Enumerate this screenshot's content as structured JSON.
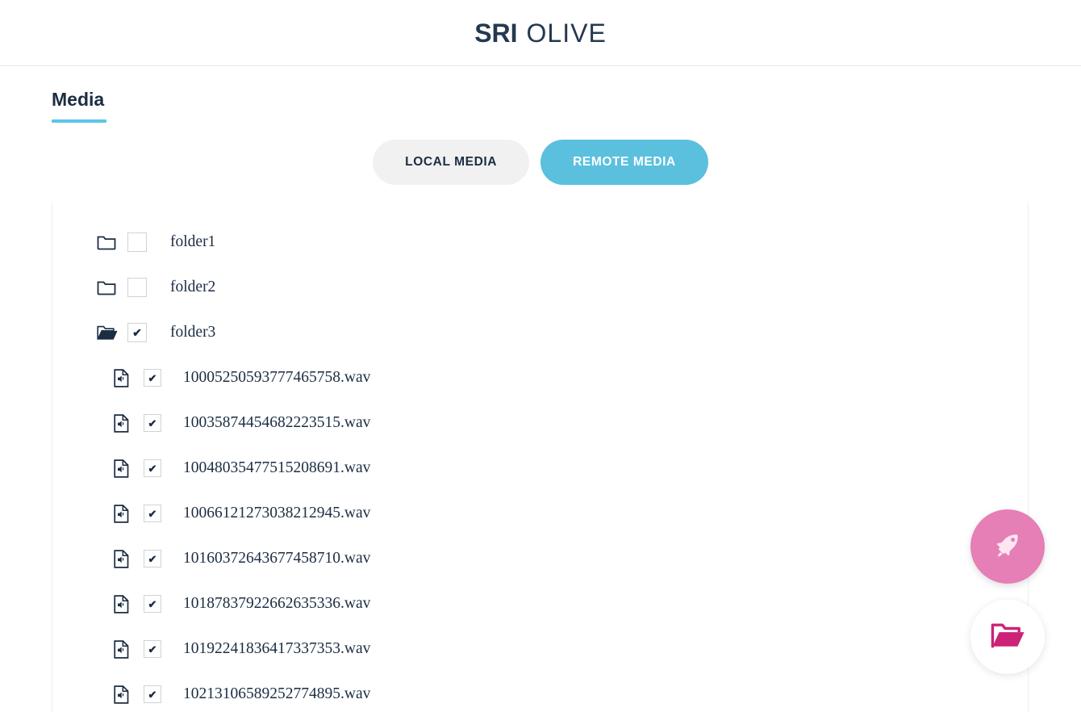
{
  "header": {
    "logo_primary": "SRI",
    "logo_secondary": "OLIVE"
  },
  "page": {
    "title": "Media",
    "accent_color": "#5bc5e8"
  },
  "tabs": [
    {
      "label": "LOCAL MEDIA",
      "active": false,
      "name": "tab-local-media"
    },
    {
      "label": "REMOTE MEDIA",
      "active": true,
      "name": "tab-remote-media"
    }
  ],
  "tree": {
    "folders": [
      {
        "label": "folder1",
        "checked": false,
        "open": false,
        "icon": "folder-closed-icon"
      },
      {
        "label": "folder2",
        "checked": false,
        "open": false,
        "icon": "folder-closed-icon"
      },
      {
        "label": "folder3",
        "checked": true,
        "open": true,
        "icon": "folder-open-icon"
      }
    ],
    "files": [
      {
        "label": "10005250593777465758.wav",
        "checked": true,
        "icon": "audio-file-icon"
      },
      {
        "label": "10035874454682223515.wav",
        "checked": true,
        "icon": "audio-file-icon"
      },
      {
        "label": "10048035477515208691.wav",
        "checked": true,
        "icon": "audio-file-icon"
      },
      {
        "label": "10066121273038212945.wav",
        "checked": true,
        "icon": "audio-file-icon"
      },
      {
        "label": "10160372643677458710.wav",
        "checked": true,
        "icon": "audio-file-icon"
      },
      {
        "label": "10187837922662635336.wav",
        "checked": true,
        "icon": "audio-file-icon"
      },
      {
        "label": "10192241836417337353.wav",
        "checked": true,
        "icon": "audio-file-icon"
      },
      {
        "label": "10213106589252774895.wav",
        "checked": true,
        "icon": "audio-file-icon"
      }
    ],
    "checkmark_glyph": "✔"
  },
  "fabs": [
    {
      "name": "submit-job-fab",
      "icon": "rocket-icon",
      "background": "#e57fb6",
      "icon_color": "#fde6f2"
    },
    {
      "name": "open-folder-fab",
      "icon": "folder-open-icon",
      "background": "#ffffff",
      "icon_color": "#cc2277"
    }
  ]
}
